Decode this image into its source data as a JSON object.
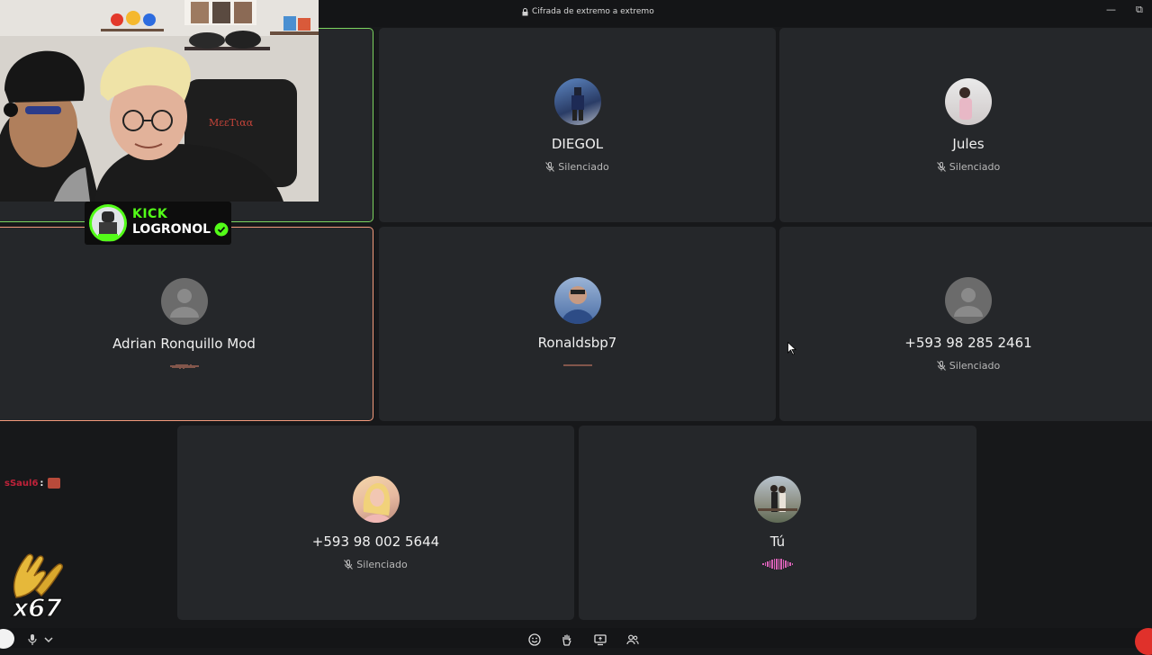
{
  "window": {
    "encryption_label": "Cifrada de extremo a extremo",
    "minimize_glyph": "—",
    "maximize_glyph": "⧉"
  },
  "participants": [
    {
      "name": "DIEGOL",
      "status": "Silenciado",
      "muted": true,
      "avatar": "photo"
    },
    {
      "name": "Jules",
      "status": "Silenciado",
      "muted": true,
      "avatar": "photo"
    },
    {
      "name": "Adrian Ronquillo Mod",
      "status": "",
      "muted": false,
      "speaking": true,
      "avatar": "default"
    },
    {
      "name": "Ronaldsbp7",
      "status": "",
      "muted": false,
      "avatar": "photo"
    },
    {
      "name": "+593 98 285 2461",
      "status": "Silenciado",
      "muted": true,
      "avatar": "default"
    },
    {
      "name": "+593 98 002 5644",
      "status": "Silenciado",
      "muted": true,
      "avatar": "photo"
    },
    {
      "name": "Tú",
      "status": "",
      "muted": false,
      "speaking": true,
      "avatar": "photo"
    }
  ],
  "overlay": {
    "kick_label": "KICK",
    "streamer_name": "LOGRONOL",
    "chat_user": "sSaul6",
    "chat_sep": ":",
    "clap_count": "x67"
  },
  "bottom_toolbar": {
    "icons": [
      "mic-icon",
      "chevron-down-icon",
      "emoji-icon",
      "raise-hand-icon",
      "share-screen-icon",
      "people-icon"
    ]
  },
  "colors": {
    "accent_green": "#7bd35f",
    "accent_orange": "#f39a7c",
    "kick_green": "#53fc18",
    "wave_pink": "#d861b6",
    "end_call_red": "#e0312b"
  }
}
